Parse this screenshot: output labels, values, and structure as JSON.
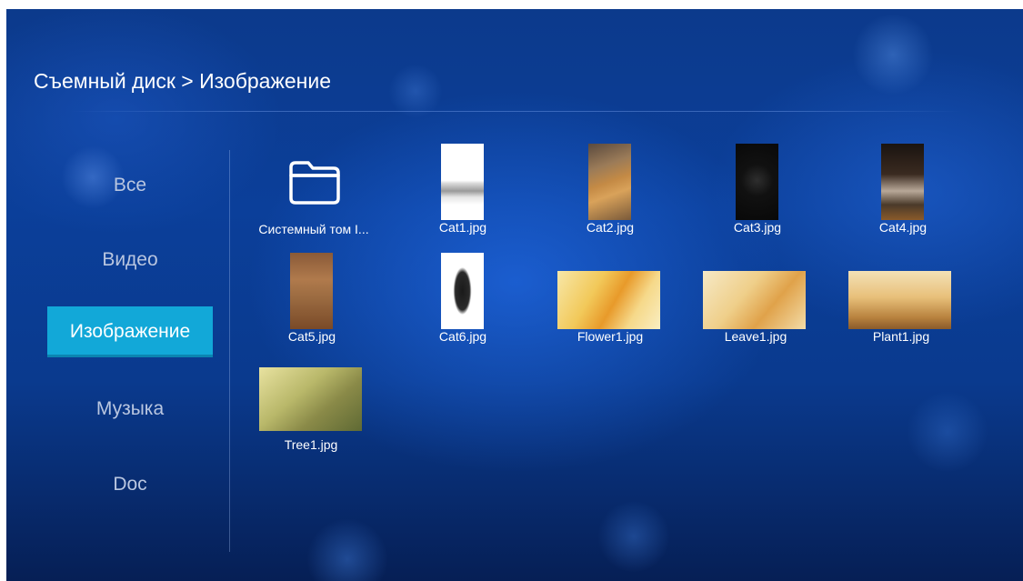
{
  "breadcrumb": "Съемный диск > Изображение",
  "sidebar": {
    "items": [
      {
        "label": "Все",
        "active": false
      },
      {
        "label": "Видео",
        "active": false
      },
      {
        "label": "Изображение",
        "active": true
      },
      {
        "label": "Музыка",
        "active": false
      },
      {
        "label": "Doc",
        "active": false
      }
    ]
  },
  "files": [
    {
      "name": "Системный том I...",
      "type": "folder",
      "icon": "folder-icon"
    },
    {
      "name": "Cat1.jpg",
      "type": "image"
    },
    {
      "name": "Cat2.jpg",
      "type": "image"
    },
    {
      "name": "Cat3.jpg",
      "type": "image"
    },
    {
      "name": "Cat4.jpg",
      "type": "image"
    },
    {
      "name": "Cat5.jpg",
      "type": "image"
    },
    {
      "name": "Cat6.jpg",
      "type": "image"
    },
    {
      "name": "Flower1.jpg",
      "type": "image"
    },
    {
      "name": "Leave1.jpg",
      "type": "image"
    },
    {
      "name": "Plant1.jpg",
      "type": "image"
    },
    {
      "name": "Tree1.jpg",
      "type": "image"
    }
  ],
  "colors": {
    "accent": "#12a8d8",
    "background": "#0b3f9a",
    "text": "#ffffff",
    "inactive_text": "#b9c6e0"
  }
}
